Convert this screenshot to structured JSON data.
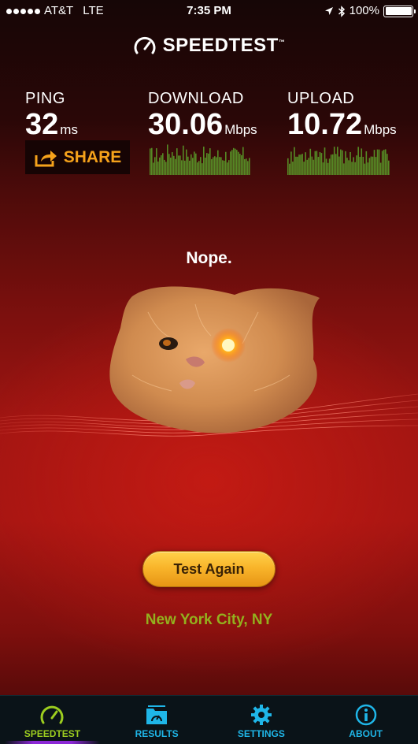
{
  "status_bar": {
    "carrier": "AT&T",
    "network": "LTE",
    "time": "7:35 PM",
    "battery": "100%",
    "signal_bars": 5
  },
  "brand": {
    "name": "SPEEDTEST",
    "trademark": "™",
    "icon": "speedometer-icon"
  },
  "metrics": {
    "ping": {
      "label": "PING",
      "value": "32",
      "unit": "ms"
    },
    "download": {
      "label": "DOWNLOAD",
      "value": "30.06",
      "unit": "Mbps"
    },
    "upload": {
      "label": "UPLOAD",
      "value": "10.72",
      "unit": "Mbps"
    }
  },
  "share": {
    "label": "SHARE",
    "icon": "share-arrow-icon"
  },
  "result": {
    "caption": "Nope."
  },
  "actions": {
    "test_again": "Test Again"
  },
  "location": "New York City, NY",
  "tabs": [
    {
      "label": "SPEEDTEST",
      "icon": "speedometer-icon",
      "active": true
    },
    {
      "label": "RESULTS",
      "icon": "results-folder-icon",
      "active": false
    },
    {
      "label": "SETTINGS",
      "icon": "gear-icon",
      "active": false
    },
    {
      "label": "ABOUT",
      "icon": "info-icon",
      "active": false
    }
  ],
  "colors": {
    "accent_orange": "#f5a21b",
    "location_green": "#93b01e",
    "tab_blue": "#1fb6e8",
    "tab_active_green": "#9ccd1f",
    "sparkline_green": "#5aa12a"
  }
}
